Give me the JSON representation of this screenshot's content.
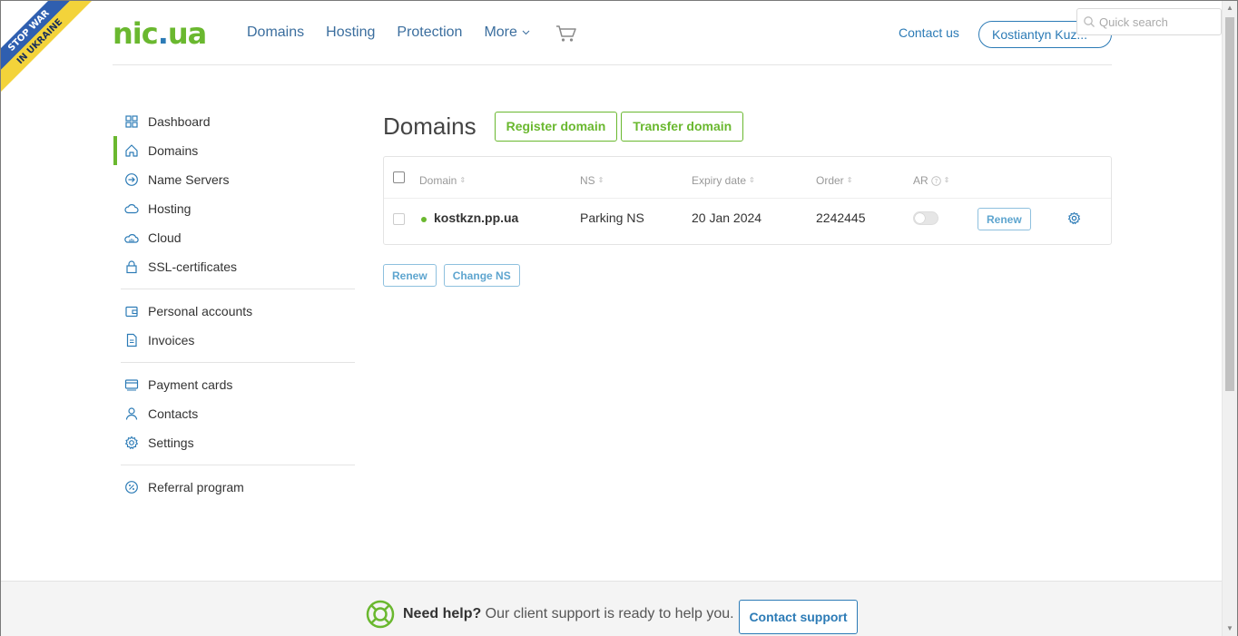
{
  "ribbon": {
    "line1": "STOP WAR",
    "line2": "IN UKRAINE"
  },
  "header": {
    "logo_main": "nic",
    "logo_dot": ".",
    "logo_tld": "ua",
    "nav": [
      "Domains",
      "Hosting",
      "Protection",
      "More"
    ],
    "contact_us": "Contact us",
    "user": "Kostiantyn Kuz...",
    "search_placeholder": "Quick search"
  },
  "sidebar": {
    "group1": [
      {
        "label": "Dashboard",
        "icon": "dashboard-icon"
      },
      {
        "label": "Domains",
        "icon": "home-icon",
        "active": true
      },
      {
        "label": "Name Servers",
        "icon": "arrow-circle-icon"
      },
      {
        "label": "Hosting",
        "icon": "cloud-icon"
      },
      {
        "label": "Cloud",
        "icon": "cloud-server-icon"
      },
      {
        "label": "SSL-certificates",
        "icon": "lock-icon"
      }
    ],
    "group2": [
      {
        "label": "Personal accounts",
        "icon": "wallet-icon"
      },
      {
        "label": "Invoices",
        "icon": "document-icon"
      }
    ],
    "group3": [
      {
        "label": "Payment cards",
        "icon": "card-icon"
      },
      {
        "label": "Contacts",
        "icon": "user-icon"
      },
      {
        "label": "Settings",
        "icon": "gear-icon"
      }
    ],
    "group4": [
      {
        "label": "Referral program",
        "icon": "percent-icon"
      }
    ]
  },
  "main": {
    "title": "Domains",
    "register_btn": "Register domain",
    "transfer_btn": "Transfer domain",
    "columns": {
      "domain": "Domain",
      "ns": "NS",
      "expiry": "Expiry date",
      "order": "Order",
      "ar": "AR"
    },
    "rows": [
      {
        "domain": "kostkzn.pp.ua",
        "ns": "Parking NS",
        "expiry": "20 Jan 2024",
        "order": "2242445",
        "ar_enabled": false,
        "action": "Renew"
      }
    ],
    "bulk_renew": "Renew",
    "bulk_change_ns": "Change NS"
  },
  "footer": {
    "help_bold": "Need help?",
    "help_text": " Our client support is ready to help you.",
    "support_btn": "Contact support"
  },
  "colors": {
    "brand_green": "#6ab82f",
    "brand_blue": "#2c7bb6"
  }
}
